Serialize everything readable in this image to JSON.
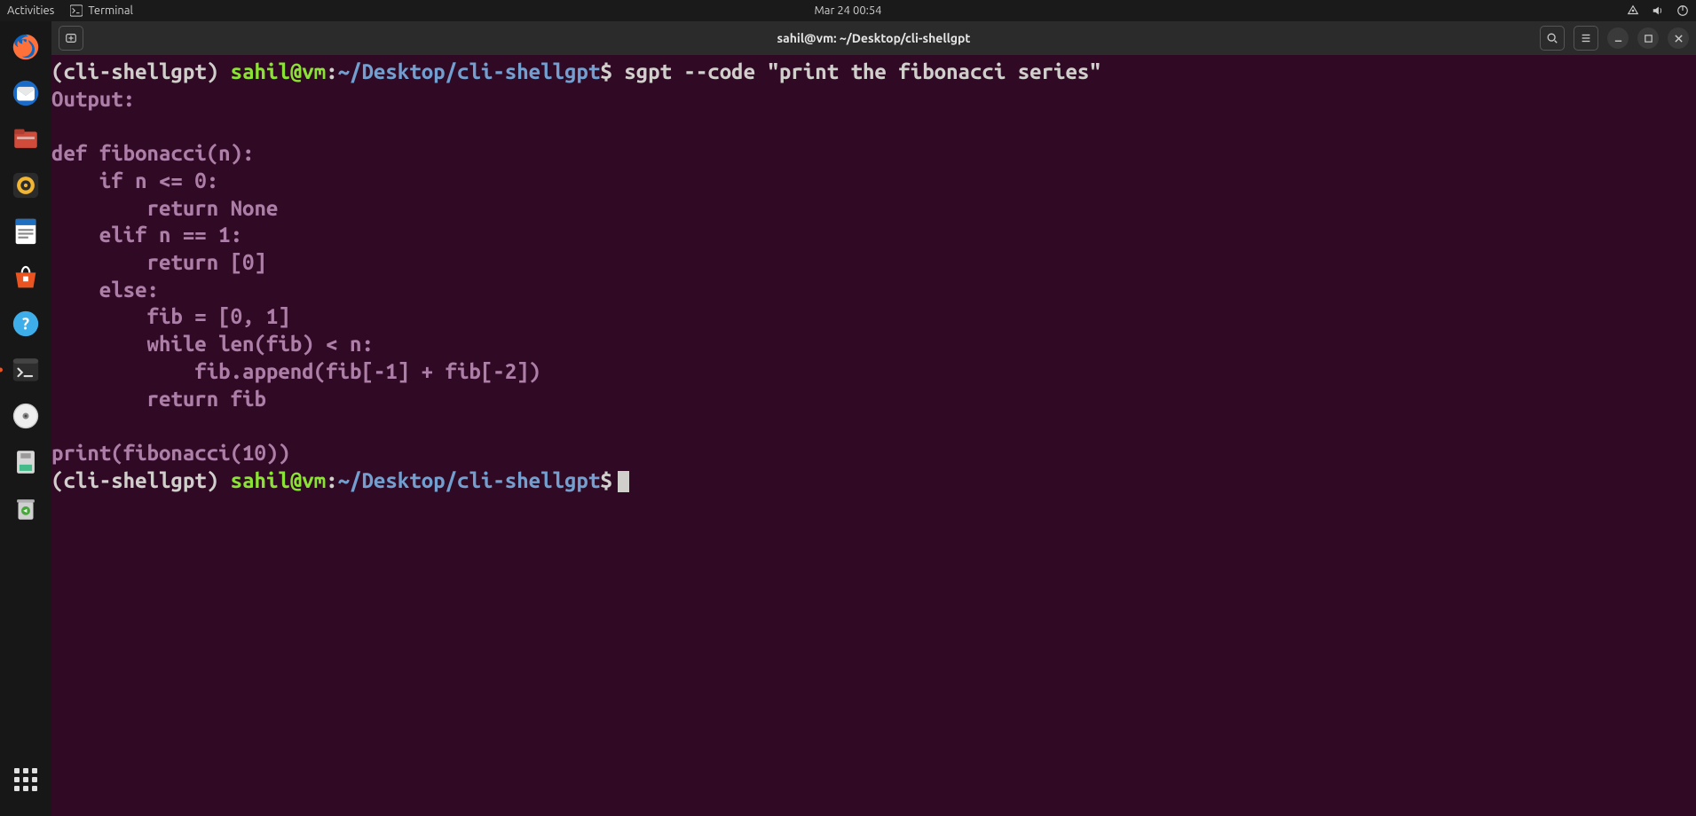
{
  "top_bar": {
    "activities": "Activities",
    "app_label": "Terminal",
    "clock": "Mar 24  00:54"
  },
  "dock": {
    "items": [
      {
        "name": "firefox-icon"
      },
      {
        "name": "thunderbird-icon"
      },
      {
        "name": "files-icon"
      },
      {
        "name": "rhythmbox-icon"
      },
      {
        "name": "writer-icon"
      },
      {
        "name": "software-icon"
      },
      {
        "name": "help-icon"
      },
      {
        "name": "terminal-icon",
        "running": true
      },
      {
        "name": "discs-icon"
      },
      {
        "name": "removable-icon"
      },
      {
        "name": "trash-icon"
      }
    ]
  },
  "window": {
    "title": "sahil@vm: ~/Desktop/cli-shellgpt"
  },
  "prompt": {
    "env": "(cli-shellgpt)",
    "user_host": "sahil@vm",
    "colon": ":",
    "path": "~/Desktop/cli-shellgpt",
    "dollar": "$"
  },
  "terminal": {
    "cmd1": " sgpt --code \"print the fibonacci series\"",
    "output_label": "Output:",
    "code": "def fibonacci(n):\n    if n <= 0:\n        return None\n    elif n == 1:\n        return [0]\n    else:\n        fib = [0, 1]\n        while len(fib) < n:\n            fib.append(fib[-1] + fib[-2])\n        return fib\n\nprint(fibonacci(10))"
  }
}
